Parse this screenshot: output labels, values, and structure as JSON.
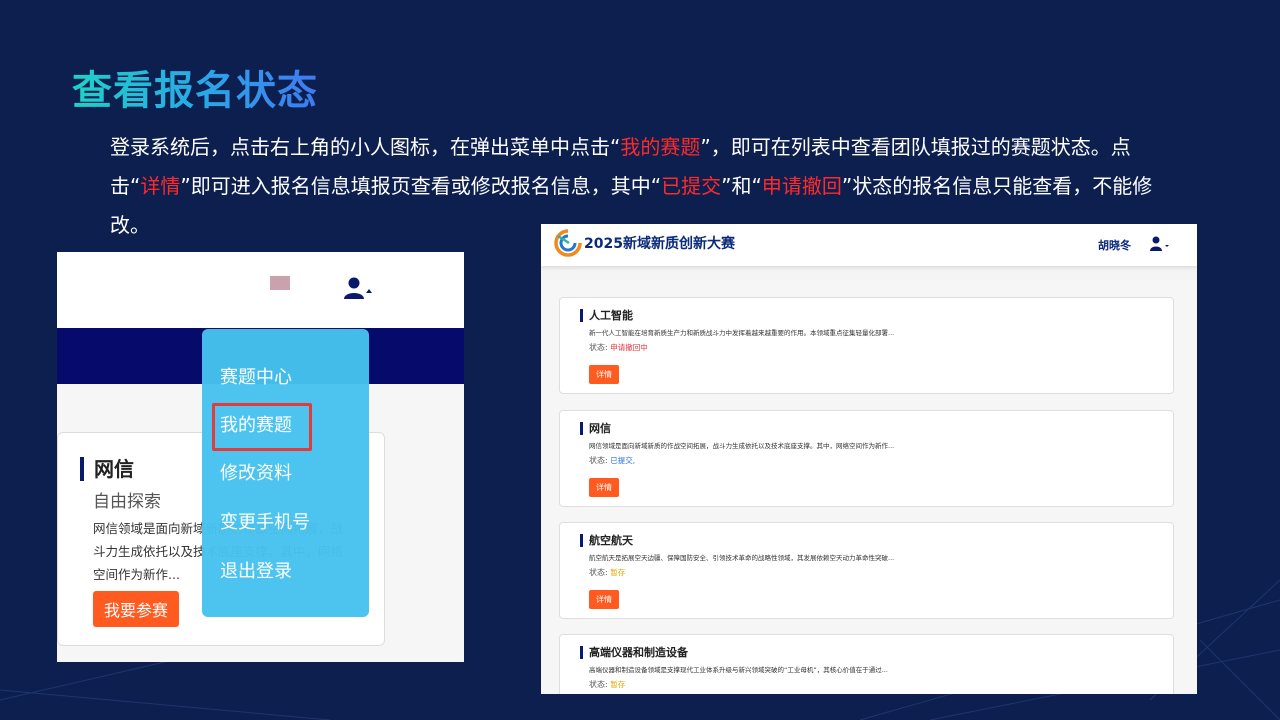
{
  "slide": {
    "title": "查看报名状态",
    "desc_parts": [
      "登录系统后，点击右上角的小人图标，在弹出菜单中点击“",
      "我的赛题",
      "”，即可在列表中查看团队填报过的赛题状态。点击“",
      "详情",
      "”即可进入报名信息填报页查看或修改报名信息，其中“",
      "已提交",
      "”和“",
      "申请撤回",
      "”状态的报名信息只能查看，不能修改。"
    ]
  },
  "left_shot": {
    "card": {
      "title": "网信",
      "subtitle": "自由探索",
      "desc": "网信领域是面向新域新质的作战空间拓展，战斗力生成依托以及技术底座支撑。其中，网络空间作为新作...",
      "button": "我要参赛"
    },
    "menu": [
      "赛题中心",
      "我的赛题",
      "修改资料",
      "变更手机号",
      "退出登录"
    ],
    "icons": {
      "user": "user-icon",
      "caret": "caret-up-icon"
    }
  },
  "right_shot": {
    "brand": "2025新域新质创新大赛",
    "username": "胡晓冬",
    "status_label": "状态:",
    "detail_button": "详情",
    "cards": [
      {
        "title": "人工智能",
        "desc": "新一代人工智能在培育新质生产力和新质战斗力中发挥着越来越重要的作用。本领域重点征集轻量化部署...",
        "status": "申请撤回中",
        "status_color": "#e5323a"
      },
      {
        "title": "网信",
        "desc": "网信领域是面向新域新质的作战空间拓展，战斗力生成依托以及技术底座支撑。其中，网络空间作为新作...",
        "status": "已提交,",
        "status_color": "#2a6fdb"
      },
      {
        "title": "航空航天",
        "desc": "航空航天是拓展空天边疆、保障国防安全、引领技术革命的战略性领域，其发展依赖空天动力革命性突破...",
        "status": "暂存",
        "status_color": "#e0a800"
      },
      {
        "title": "高端仪器和制造设备",
        "desc": "高端仪器和制造设备领域是支撑现代工业体系升级与新兴领域突破的“工业母机”，其核心价值在于通过...",
        "status": "暂存",
        "status_color": "#e0a800"
      }
    ]
  },
  "colors": {
    "background": "#0d1f4f",
    "highlight": "#ff2a2a",
    "menu": "#46c2ee",
    "button": "#ff5a1f",
    "navy": "#050a6b"
  }
}
